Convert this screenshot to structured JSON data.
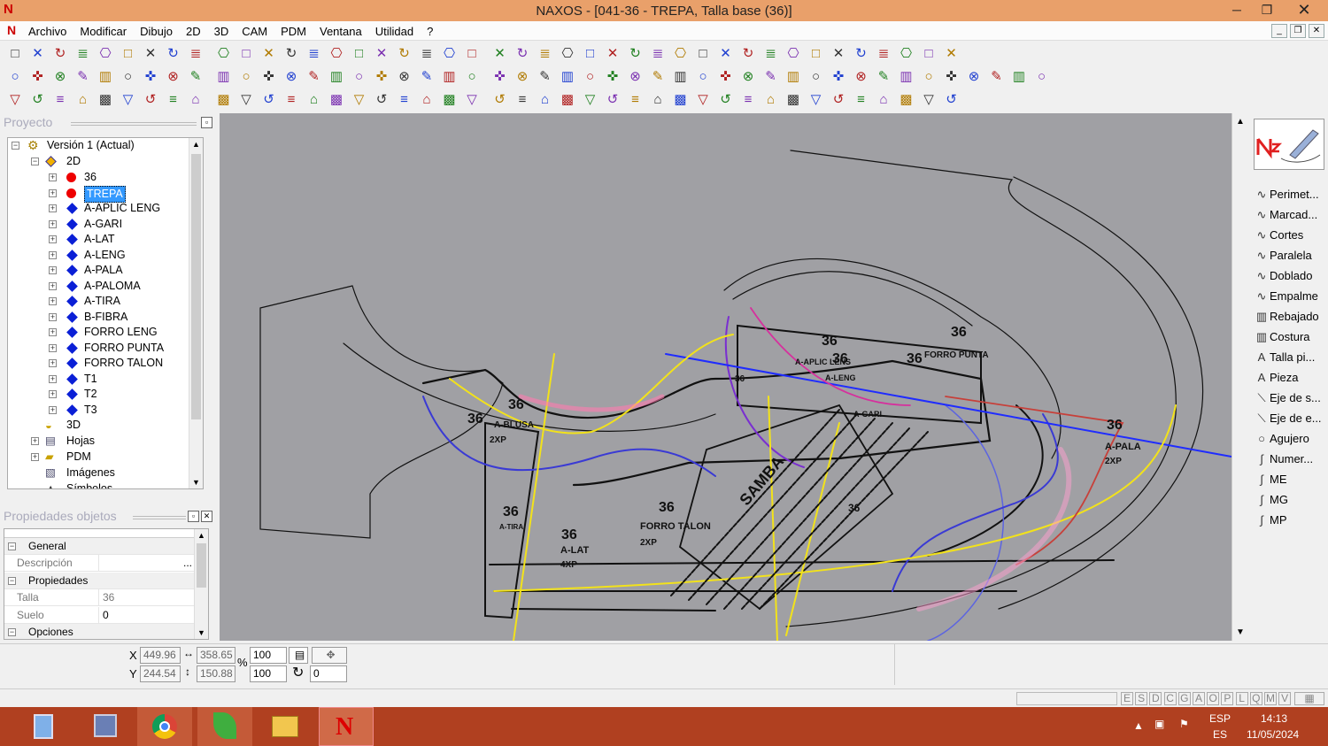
{
  "window": {
    "title": "NAXOS - [041-36 - TREPA, Talla base (36)]",
    "logo_icon": "naxos-logo-icon"
  },
  "menu": [
    "Archivo",
    "Modificar",
    "Dibujo",
    "2D",
    "3D",
    "CAM",
    "PDM",
    "Ventana",
    "Utilidad",
    "?"
  ],
  "project_panel": {
    "title": "Proyecto",
    "root": "Versión 1 (Actual)",
    "node_2d": "2D",
    "pieces": [
      {
        "label": "36",
        "marker": "red-dot"
      },
      {
        "label": "TREPA",
        "marker": "red-dot",
        "selected": true
      },
      {
        "label": "A-APLIC LENG",
        "marker": "blue-diamond"
      },
      {
        "label": "A-GARI",
        "marker": "blue-diamond"
      },
      {
        "label": "A-LAT",
        "marker": "blue-diamond"
      },
      {
        "label": "A-LENG",
        "marker": "blue-diamond"
      },
      {
        "label": "A-PALA",
        "marker": "blue-diamond"
      },
      {
        "label": "A-PALOMA",
        "marker": "blue-diamond"
      },
      {
        "label": "A-TIRA",
        "marker": "blue-diamond"
      },
      {
        "label": "B-FIBRA",
        "marker": "blue-diamond"
      },
      {
        "label": "FORRO LENG",
        "marker": "blue-diamond"
      },
      {
        "label": "FORRO PUNTA",
        "marker": "blue-diamond"
      },
      {
        "label": "FORRO TALON",
        "marker": "blue-diamond"
      },
      {
        "label": "T1",
        "marker": "blue-diamond"
      },
      {
        "label": "T2",
        "marker": "blue-diamond"
      },
      {
        "label": "T3",
        "marker": "blue-diamond"
      }
    ],
    "others": [
      "3D",
      "Hojas",
      "PDM",
      "Imágenes",
      "Símbolos"
    ]
  },
  "properties_panel": {
    "title": "Propiedades objetos",
    "groups": {
      "general": "General",
      "props": "Propiedades",
      "options": "Opciones"
    },
    "rows": {
      "descripcion": "Descripción",
      "descripcion_btn": "...",
      "talla_k": "Talla",
      "talla_v": "36",
      "suelo_k": "Suelo",
      "suelo_v": "0"
    }
  },
  "canvas": {
    "labels": [
      "36",
      "36",
      "36",
      "36",
      "36",
      "36",
      "36",
      "36",
      "36",
      "36",
      "36",
      "36"
    ],
    "texts": {
      "ablusa": "A-BLUSA",
      "lens": "A-APLIC LENS",
      "aleng": "A-LENG",
      "forro_punta": "FORRO PUNTA",
      "forro_talon": "FORRO TALON",
      "alat": "A-LAT",
      "apala": "A-PALA",
      "agari": "A-GARI",
      "atira": "A-TIRA",
      "samba": "SAMBA",
      "x2": "2XP",
      "x4": "4XP"
    }
  },
  "right_tools": [
    "Perimet...",
    "Marcad...",
    "Cortes",
    "Paralela",
    "Doblado",
    "Empalme",
    "Rebajado",
    "Costura",
    "Talla pi...",
    "Pieza",
    "Eje de s...",
    "Eje de e...",
    "Agujero",
    "Numer...",
    "ME",
    "MG",
    "MP"
  ],
  "coords": {
    "x_label": "X",
    "y_label": "Y",
    "x": "449.96",
    "y": "244.54",
    "w": "358.65",
    "h": "150.88",
    "sx": "100",
    "sy": "100",
    "pct": "%",
    "rot": "0"
  },
  "status_letters": [
    "E",
    "S",
    "D",
    "C",
    "G",
    "A",
    "O",
    "P",
    "L",
    "Q",
    "M",
    "V"
  ],
  "tray": {
    "lang1": "ESP",
    "lang2": "ES",
    "time": "14:13",
    "date": "11/05/2024"
  }
}
